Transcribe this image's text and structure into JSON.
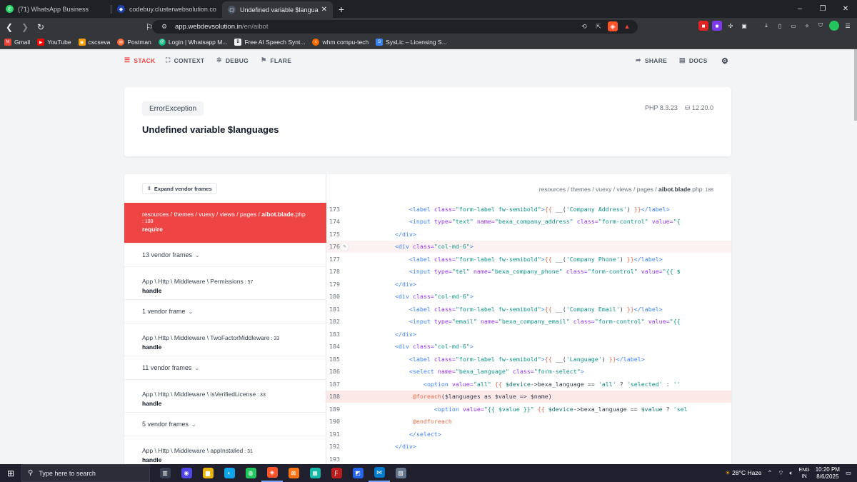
{
  "browser": {
    "tabs": [
      {
        "label": "(71) WhatsApp Business",
        "icon": "whatsapp-icon",
        "color": "#25d366"
      },
      {
        "label": "codebuy.clusterwebsolution.com/pro",
        "icon": "codebuy-icon",
        "color": "#1e40af"
      },
      {
        "label": "Undefined variable $languages",
        "icon": "flare-icon",
        "color": "#6b7280"
      }
    ],
    "new_tab": "+",
    "url_host": "app.webdevsolution.in",
    "url_path": "/en/aibot",
    "window_controls": [
      "–",
      "❐",
      "✕"
    ],
    "bookmarks": [
      {
        "label": "Gmail",
        "icon": "gmail-icon",
        "color": "#ea4335"
      },
      {
        "label": "YouTube",
        "icon": "youtube-icon",
        "color": "#ff0000"
      },
      {
        "label": "cscseva",
        "icon": "cscseva-icon",
        "color": "#f59e0b"
      },
      {
        "label": "Postman",
        "icon": "postman-icon",
        "color": "#ff6c37"
      },
      {
        "label": "Login | Whatsapp M...",
        "icon": "whatsapp-login-icon",
        "color": "#10b981"
      },
      {
        "label": "Free AI Speech Synt...",
        "icon": "speech-icon",
        "color": "#6b7280"
      },
      {
        "label": "whm compu-tech",
        "icon": "whm-icon",
        "color": "#ff6a00"
      },
      {
        "label": "SysLic – Licensing S...",
        "icon": "syslic-icon",
        "color": "#3b82f6"
      }
    ]
  },
  "nav": {
    "stack": "STACK",
    "context": "CONTEXT",
    "debug": "DEBUG",
    "flare": "FLARE",
    "share": "SHARE",
    "docs": "DOCS"
  },
  "error": {
    "exception_class": "ErrorException",
    "message": "Undefined variable $languages",
    "php_version": "PHP 8.3.23",
    "laravel_version": "12.20.0"
  },
  "stack": {
    "expand_label": "Expand vendor frames",
    "file_path_prefix": "resources / themes / vuexy / views / pages / ",
    "file_name": "aibot.blade",
    "file_ext": ".php",
    "file_line": ": 188",
    "frames": [
      {
        "type": "app",
        "path": "resources / themes / vuexy / views / pages / ",
        "file": "aibot.blade",
        "ext": ".php",
        "line": ": 188",
        "method": "require",
        "selected": true
      },
      {
        "type": "vendor",
        "label": "13 vendor frames"
      },
      {
        "type": "app",
        "path": "App \\ Http \\ Middleware \\ Permissions",
        "line": " : 57",
        "method": "handle"
      },
      {
        "type": "vendor",
        "label": "1 vendor frame"
      },
      {
        "type": "app",
        "path": "App \\ Http \\ Middleware \\ TwoFactorMiddleware",
        "line": " : 33",
        "method": "handle"
      },
      {
        "type": "vendor",
        "label": "11 vendor frames"
      },
      {
        "type": "app",
        "path": "App \\ Http \\ Middleware \\ isVerifiedLicense",
        "line": " : 33",
        "method": "handle"
      },
      {
        "type": "vendor",
        "label": "5 vendor frames"
      },
      {
        "type": "app",
        "path": "App \\ Http \\ Middleware \\ appInstalled",
        "line": " : 31",
        "method": "handle"
      }
    ],
    "highlight_line": 188,
    "hover_line": 176,
    "code_lines": [
      {
        "n": "173",
        "html": "                <span class=\"t-tag\">&lt;label</span> <span class=\"t-attr\">class=</span><span class=\"t-str\">\"form-label fw-semibold\"</span><span class=\"t-tag\">&gt;</span><span class=\"t-blade\">{{</span> __(<span class=\"t-str\">'Company Address'</span>) <span class=\"t-blade\">}}</span><span class=\"t-tag\">&lt;/label&gt;</span>"
      },
      {
        "n": "174",
        "html": "                <span class=\"t-tag\">&lt;input</span> <span class=\"t-attr\">type=</span><span class=\"t-str\">\"text\"</span> <span class=\"t-attr\">name=</span><span class=\"t-str\">\"bexa_company_address\"</span> <span class=\"t-attr\">class=</span><span class=\"t-str\">\"form-control\"</span> <span class=\"t-attr\">value=</span><span class=\"t-str\">\"{</span>"
      },
      {
        "n": "175",
        "html": "            <span class=\"t-tag\">&lt;/div&gt;</span>"
      },
      {
        "n": "176",
        "html": "            <span class=\"t-tag\">&lt;div</span> <span class=\"t-attr\">class=</span><span class=\"t-str\">\"col-md-6\"</span><span class=\"t-tag\">&gt;</span>"
      },
      {
        "n": "177",
        "html": "                <span class=\"t-tag\">&lt;label</span> <span class=\"t-attr\">class=</span><span class=\"t-str\">\"form-label fw-semibold\"</span><span class=\"t-tag\">&gt;</span><span class=\"t-blade\">{{</span> __(<span class=\"t-str\">'Company Phone'</span>) <span class=\"t-blade\">}}</span><span class=\"t-tag\">&lt;/label&gt;</span>"
      },
      {
        "n": "178",
        "html": "                <span class=\"t-tag\">&lt;input</span> <span class=\"t-attr\">type=</span><span class=\"t-str\">\"tel\"</span> <span class=\"t-attr\">name=</span><span class=\"t-str\">\"bexa_company_phone\"</span> <span class=\"t-attr\">class=</span><span class=\"t-str\">\"form-control\"</span> <span class=\"t-attr\">value=</span><span class=\"t-str\">\"{{ $</span>"
      },
      {
        "n": "179",
        "html": "            <span class=\"t-tag\">&lt;/div&gt;</span>"
      },
      {
        "n": "180",
        "html": "            <span class=\"t-tag\">&lt;div</span> <span class=\"t-attr\">class=</span><span class=\"t-str\">\"col-md-6\"</span><span class=\"t-tag\">&gt;</span>"
      },
      {
        "n": "181",
        "html": "                <span class=\"t-tag\">&lt;label</span> <span class=\"t-attr\">class=</span><span class=\"t-str\">\"form-label fw-semibold\"</span><span class=\"t-tag\">&gt;</span><span class=\"t-blade\">{{</span> __(<span class=\"t-str\">'Company Email'</span>) <span class=\"t-blade\">}}</span><span class=\"t-tag\">&lt;/label&gt;</span>"
      },
      {
        "n": "182",
        "html": "                <span class=\"t-tag\">&lt;input</span> <span class=\"t-attr\">type=</span><span class=\"t-str\">\"email\"</span> <span class=\"t-attr\">name=</span><span class=\"t-str\">\"bexa_company_email\"</span> <span class=\"t-attr\">class=</span><span class=\"t-str\">\"form-control\"</span> <span class=\"t-attr\">value=</span><span class=\"t-str\">\"{{</span>"
      },
      {
        "n": "183",
        "html": "            <span class=\"t-tag\">&lt;/div&gt;</span>"
      },
      {
        "n": "184",
        "html": "            <span class=\"t-tag\">&lt;div</span> <span class=\"t-attr\">class=</span><span class=\"t-str\">\"col-md-6\"</span><span class=\"t-tag\">&gt;</span>"
      },
      {
        "n": "185",
        "html": "                <span class=\"t-tag\">&lt;label</span> <span class=\"t-attr\">class=</span><span class=\"t-str\">\"form-label fw-semibold\"</span><span class=\"t-tag\">&gt;</span><span class=\"t-blade\">{{</span> __(<span class=\"t-str\">'Language'</span>) <span class=\"t-blade\">}}</span><span class=\"t-tag\">&lt;/label&gt;</span>"
      },
      {
        "n": "186",
        "html": "                <span class=\"t-tag\">&lt;select</span> <span class=\"t-attr\">name=</span><span class=\"t-str\">\"bexa_language\"</span> <span class=\"t-attr\">class=</span><span class=\"t-str\">\"form-select\"</span><span class=\"t-tag\">&gt;</span>"
      },
      {
        "n": "187",
        "html": "                    <span class=\"t-tag\">&lt;option</span> <span class=\"t-attr\">value=</span><span class=\"t-str\">\"all\"</span> <span class=\"t-blade\">{{</span> <span class=\"t-var\">$device</span>-&gt;bexa_language == <span class=\"t-str\">'all'</span> ? <span class=\"t-str\">'selected'</span> : <span class=\"t-str\">''</span>"
      },
      {
        "n": "188",
        "html": "                 <span class=\"t-blade\">@foreach</span>($languages as $value =&gt; $name)"
      },
      {
        "n": "189",
        "html": "                       <span class=\"t-tag\">&lt;option</span> <span class=\"t-attr\">value=</span><span class=\"t-str\">\"{{ $value }}\"</span> <span class=\"t-blade\">{{</span> <span class=\"t-var\">$device</span>-&gt;bexa_language == <span class=\"t-var\">$value</span> ? <span class=\"t-str\">'sel</span>"
      },
      {
        "n": "190",
        "html": "                 <span class=\"t-blade\">@endforeach</span>"
      },
      {
        "n": "191",
        "html": "                <span class=\"t-tag\">&lt;/select&gt;</span>"
      },
      {
        "n": "192",
        "html": "            <span class=\"t-tag\">&lt;/div&gt;</span>"
      },
      {
        "n": "193",
        "html": ""
      }
    ]
  },
  "taskbar": {
    "search_placeholder": "Type here to search",
    "apps": [
      {
        "icon": "task-view-icon",
        "color": "#374151"
      },
      {
        "icon": "app-icon",
        "color": "#4f46e5"
      },
      {
        "icon": "file-explorer-icon",
        "color": "#eab308"
      },
      {
        "icon": "edge-icon",
        "color": "#0ea5e9"
      },
      {
        "icon": "chrome-icon",
        "color": "#22c55e"
      },
      {
        "icon": "brave-icon",
        "color": "#fb542b",
        "run": true
      },
      {
        "icon": "xampp-icon",
        "color": "#f97316"
      },
      {
        "icon": "app-icon",
        "color": "#14b8a6"
      },
      {
        "icon": "filezilla-icon",
        "color": "#b91c1c"
      },
      {
        "icon": "app-icon",
        "color": "#2563eb"
      },
      {
        "icon": "vscode-icon",
        "color": "#007acc",
        "run": true
      },
      {
        "icon": "app-icon",
        "color": "#64748b"
      }
    ],
    "weather": "28°C  Haze",
    "lang_top": "ENG",
    "lang_bottom": "IN",
    "time": "10:20 PM",
    "date": "8/6/2025"
  }
}
